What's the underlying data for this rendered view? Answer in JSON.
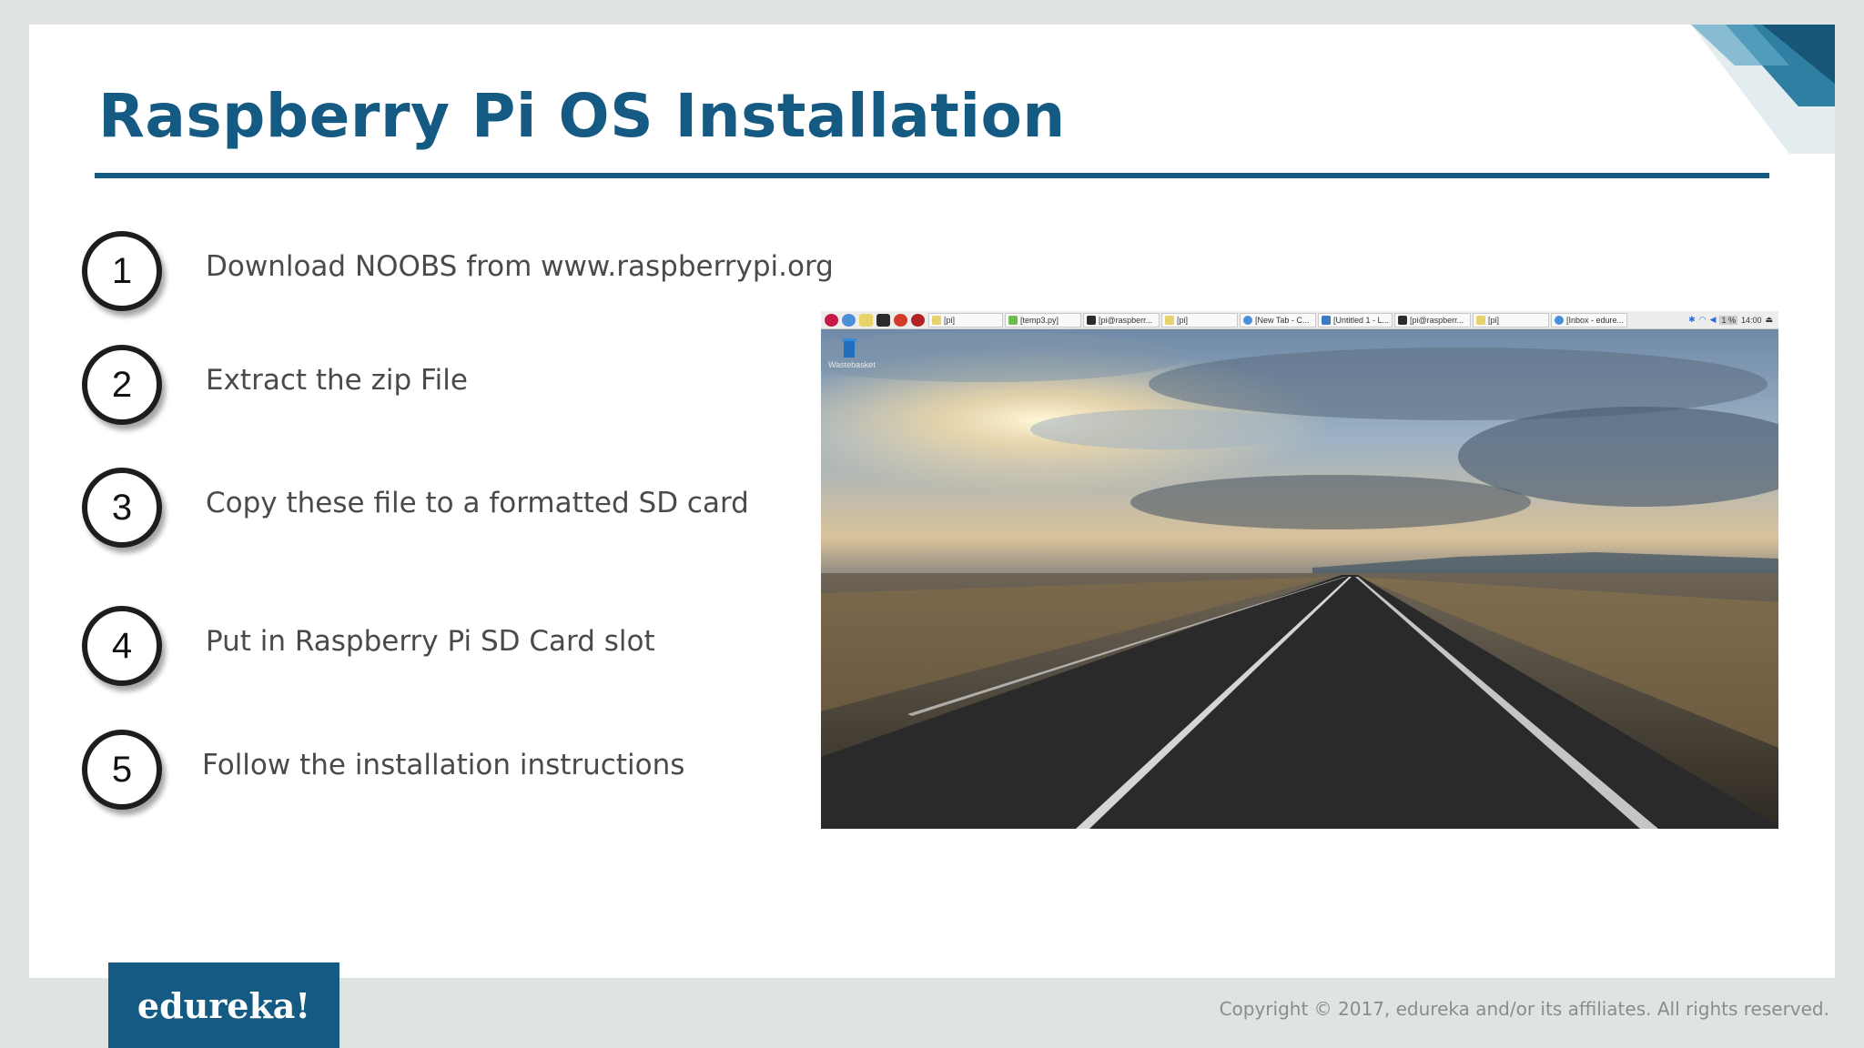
{
  "slide": {
    "title": "Raspberry Pi OS Installation",
    "steps": [
      {
        "number": "1",
        "text": "Download NOOBS from www.raspberrypi.org"
      },
      {
        "number": "2",
        "text": "Extract the zip File"
      },
      {
        "number": "3",
        "text": "Copy these file to a formatted SD card"
      },
      {
        "number": "4",
        "text": "Put in Raspberry Pi SD Card slot"
      },
      {
        "number": "5",
        "text": "Follow the installation instructions"
      }
    ],
    "colors": {
      "accent": "#155a82",
      "background": "#ffffff",
      "frame": "#dfe3e2"
    }
  },
  "screenshot": {
    "taskbar": {
      "launcher_icons": [
        "raspberry-menu-icon",
        "web-browser-icon",
        "file-manager-icon",
        "terminal-icon",
        "wolfram-icon",
        "mathematica-icon"
      ],
      "windows": [
        "[pi]",
        "[temp3.py]",
        "[pi@raspberr...",
        "[pi]",
        "[New Tab - C...",
        "[Untitled 1 - L...",
        "[pi@raspberr...",
        "[pi]",
        "[Inbox - edure..."
      ],
      "tray_icons": [
        "bluetooth-icon",
        "wifi-icon",
        "volume-icon",
        "cpu-monitor-icon",
        "eject-icon"
      ],
      "clock": "14:00",
      "cpu": "1 %"
    },
    "desktop": {
      "trash_label": "Wastebasket"
    }
  },
  "footer": {
    "logo": "edureka!",
    "copyright": "Copyright © 2017, edureka and/or its affiliates. All rights reserved."
  }
}
